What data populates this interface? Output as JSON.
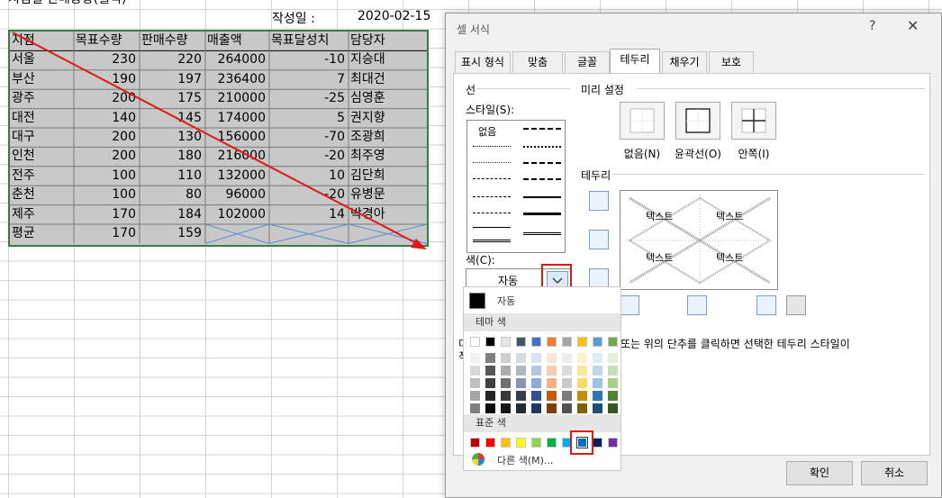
{
  "sheet": {
    "title": "지점별 판매동향(월식)",
    "date_label": "작성일 :",
    "date_value": "2020-02-15",
    "headers": [
      "지점",
      "목표수량",
      "판매수량",
      "매출액",
      "목표달성치",
      "담당자"
    ],
    "rows": [
      [
        "서울",
        "230",
        "220",
        "264000",
        "-10",
        "지승대"
      ],
      [
        "부산",
        "190",
        "197",
        "236400",
        "7",
        "최대건"
      ],
      [
        "광주",
        "200",
        "175",
        "210000",
        "-25",
        "심영훈"
      ],
      [
        "대전",
        "140",
        "145",
        "174000",
        "5",
        "권지향"
      ],
      [
        "대구",
        "200",
        "130",
        "156000",
        "-70",
        "조광희"
      ],
      [
        "인천",
        "200",
        "180",
        "216000",
        "-20",
        "최주영"
      ],
      [
        "전주",
        "100",
        "110",
        "132000",
        "10",
        "김단희"
      ],
      [
        "춘천",
        "100",
        "80",
        "96000",
        "-20",
        "유병문"
      ],
      [
        "제주",
        "170",
        "184",
        "102000",
        "14",
        "박경아"
      ]
    ],
    "avg_row": [
      "평균",
      "170",
      "159"
    ]
  },
  "dialog": {
    "title": "셀 서식",
    "help": "?",
    "close": "✕",
    "tabs": [
      "표시 형식",
      "맞춤",
      "글꼴",
      "테두리",
      "채우기",
      "보호"
    ],
    "active_tab": "테두리",
    "line_group": "선",
    "style_label": "스타일(S):",
    "style_none": "없음",
    "color_label": "색(C):",
    "color_value": "자동",
    "presets_group": "미리 설정",
    "presets": [
      "없음(N)",
      "윤곽선(O)",
      "안쪽(I)"
    ],
    "border_group": "테두리",
    "preview_text": "텍스트",
    "hint_prefix": "미",
    "hint_prefix2": "적",
    "hint_text": "또는 위의 단추를 클릭하면 선택한 테두리 스타일이",
    "ok": "확인",
    "cancel": "취소"
  },
  "palette": {
    "auto_label": "자동",
    "theme_label": "테마 색",
    "standard_label": "표준 색",
    "more_label": "다른 색(M)...",
    "theme_top": [
      "#ffffff",
      "#000000",
      "#e7e6e6",
      "#44546a",
      "#4472c4",
      "#ed7d31",
      "#a5a5a5",
      "#ffc000",
      "#5b9bd5",
      "#70ad47"
    ],
    "theme_shades": [
      [
        "#f2f2f2",
        "#7f7f7f",
        "#d0cece",
        "#d6dce4",
        "#d9e2f3",
        "#fbe5d5",
        "#ededed",
        "#fff2cc",
        "#deebf6",
        "#e2efd9"
      ],
      [
        "#d8d8d8",
        "#595959",
        "#aeabab",
        "#adb9ca",
        "#b4c6e7",
        "#f7cbac",
        "#dbdbdb",
        "#fee599",
        "#bdd7ee",
        "#c5e0b3"
      ],
      [
        "#bfbfbf",
        "#3f3f3f",
        "#757070",
        "#8496b0",
        "#8eaadb",
        "#f4b183",
        "#c9c9c9",
        "#ffd965",
        "#9cc3e5",
        "#a8d08d"
      ],
      [
        "#a5a5a5",
        "#262626",
        "#3a3838",
        "#323f4f",
        "#2f5496",
        "#c55a11",
        "#7b7b7b",
        "#bf9000",
        "#2e75b5",
        "#538135"
      ],
      [
        "#7f7f7f",
        "#0c0c0c",
        "#171616",
        "#222a35",
        "#1e3763",
        "#843c0b",
        "#525252",
        "#7f6000",
        "#1e4e79",
        "#375623"
      ]
    ],
    "standard": [
      "#c00000",
      "#ff0000",
      "#ffc000",
      "#ffff00",
      "#92d050",
      "#00b050",
      "#00b0f0",
      "#0070c0",
      "#002060",
      "#7030a0"
    ],
    "selected_standard": "#0070c0",
    "arrow_color": "#e01818",
    "table_border_color": "#3a7a4a"
  }
}
